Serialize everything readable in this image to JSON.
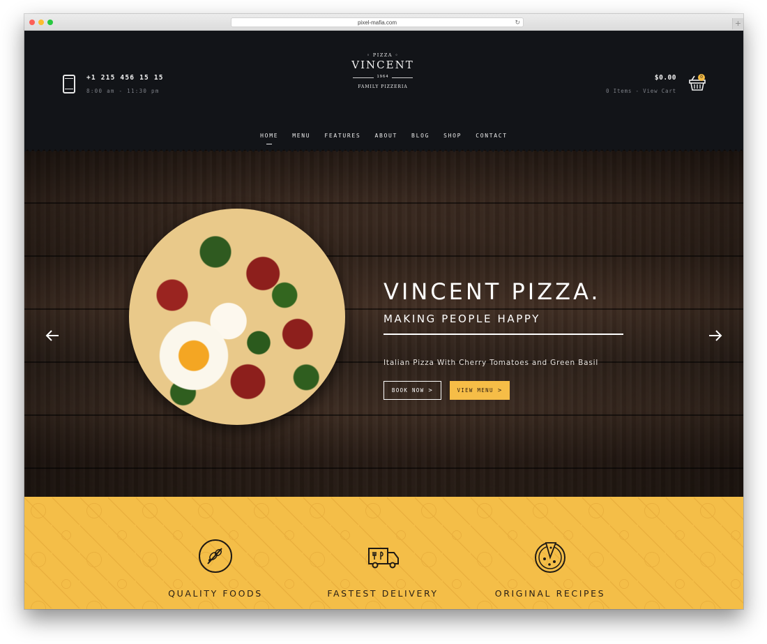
{
  "browser": {
    "url": "pixel-mafia.com",
    "new_tab": "+"
  },
  "header": {
    "phone": "+1 215 456 15 15",
    "hours": "8:00 am - 11:30 pm",
    "logo": {
      "top": "◦ PIZZA ◦",
      "name": "VINCENT",
      "year": "1964",
      "tagline": "FAMILY PIZZERIA"
    },
    "cart": {
      "amount": "$0.00",
      "summary": "0 Items - View Cart",
      "badge": "0"
    }
  },
  "nav": [
    "HOME",
    "MENU",
    "FEATURES",
    "ABOUT",
    "BLOG",
    "SHOP",
    "CONTACT"
  ],
  "hero": {
    "title": "VINCENT PIZZA.",
    "subtitle": "MAKING PEOPLE HAPPY",
    "text": "Italian Pizza With Cherry Tomatoes and Green Basil",
    "book_button": "BOOK NOW",
    "menu_button": "VIEW MENU"
  },
  "features": [
    {
      "label": "QUALITY FOODS",
      "icon": "food-plate-icon"
    },
    {
      "label": "FASTEST DELIVERY",
      "icon": "delivery-truck-icon"
    },
    {
      "label": "ORIGINAL RECIPES",
      "icon": "pizza-slice-icon"
    }
  ],
  "colors": {
    "accent": "#f6bd47",
    "header_bg": "#121418",
    "wood": "#3a2a20"
  }
}
